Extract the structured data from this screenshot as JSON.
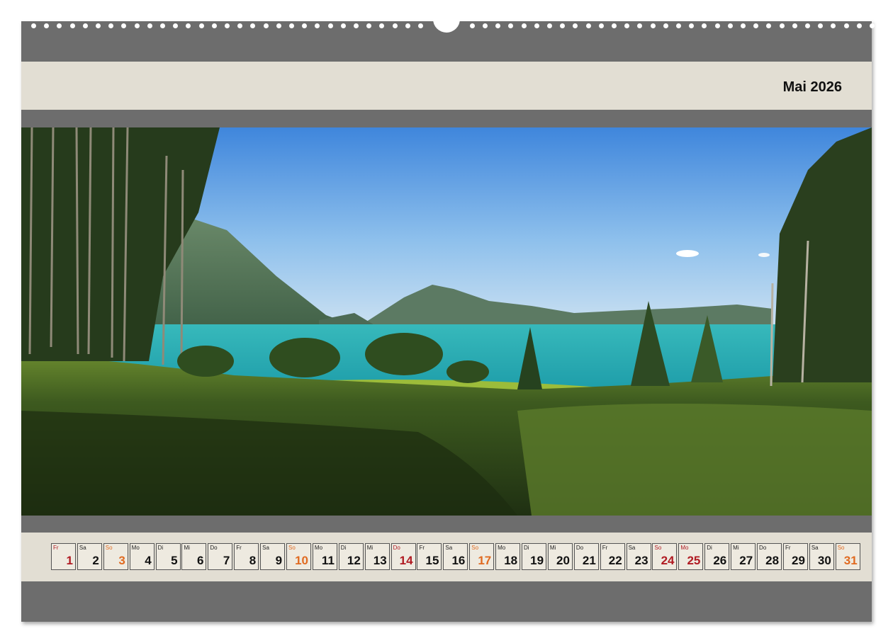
{
  "calendar": {
    "month_title": "Mai 2026",
    "colors": {
      "frame": "#6d6d6d",
      "band": "#e2ded3",
      "sunday": "#e06a20",
      "holiday": "#b01a22"
    },
    "photo_icon": "lake-landscape-photo",
    "days": [
      {
        "wd": "Fr",
        "num": "1",
        "kind": "holiday"
      },
      {
        "wd": "Sa",
        "num": "2",
        "kind": "normal"
      },
      {
        "wd": "So",
        "num": "3",
        "kind": "sunday"
      },
      {
        "wd": "Mo",
        "num": "4",
        "kind": "normal"
      },
      {
        "wd": "Di",
        "num": "5",
        "kind": "normal"
      },
      {
        "wd": "Mi",
        "num": "6",
        "kind": "normal"
      },
      {
        "wd": "Do",
        "num": "7",
        "kind": "normal"
      },
      {
        "wd": "Fr",
        "num": "8",
        "kind": "normal"
      },
      {
        "wd": "Sa",
        "num": "9",
        "kind": "normal"
      },
      {
        "wd": "So",
        "num": "10",
        "kind": "sunday"
      },
      {
        "wd": "Mo",
        "num": "11",
        "kind": "normal"
      },
      {
        "wd": "Di",
        "num": "12",
        "kind": "normal"
      },
      {
        "wd": "Mi",
        "num": "13",
        "kind": "normal"
      },
      {
        "wd": "Do",
        "num": "14",
        "kind": "holiday"
      },
      {
        "wd": "Fr",
        "num": "15",
        "kind": "normal"
      },
      {
        "wd": "Sa",
        "num": "16",
        "kind": "normal"
      },
      {
        "wd": "So",
        "num": "17",
        "kind": "sunday"
      },
      {
        "wd": "Mo",
        "num": "18",
        "kind": "normal"
      },
      {
        "wd": "Di",
        "num": "19",
        "kind": "normal"
      },
      {
        "wd": "Mi",
        "num": "20",
        "kind": "normal"
      },
      {
        "wd": "Do",
        "num": "21",
        "kind": "normal"
      },
      {
        "wd": "Fr",
        "num": "22",
        "kind": "normal"
      },
      {
        "wd": "Sa",
        "num": "23",
        "kind": "normal"
      },
      {
        "wd": "So",
        "num": "24",
        "kind": "holiday"
      },
      {
        "wd": "Mo",
        "num": "25",
        "kind": "holiday"
      },
      {
        "wd": "Di",
        "num": "26",
        "kind": "normal"
      },
      {
        "wd": "Mi",
        "num": "27",
        "kind": "normal"
      },
      {
        "wd": "Do",
        "num": "28",
        "kind": "normal"
      },
      {
        "wd": "Fr",
        "num": "29",
        "kind": "normal"
      },
      {
        "wd": "Sa",
        "num": "30",
        "kind": "normal"
      },
      {
        "wd": "So",
        "num": "31",
        "kind": "sunday"
      }
    ]
  }
}
